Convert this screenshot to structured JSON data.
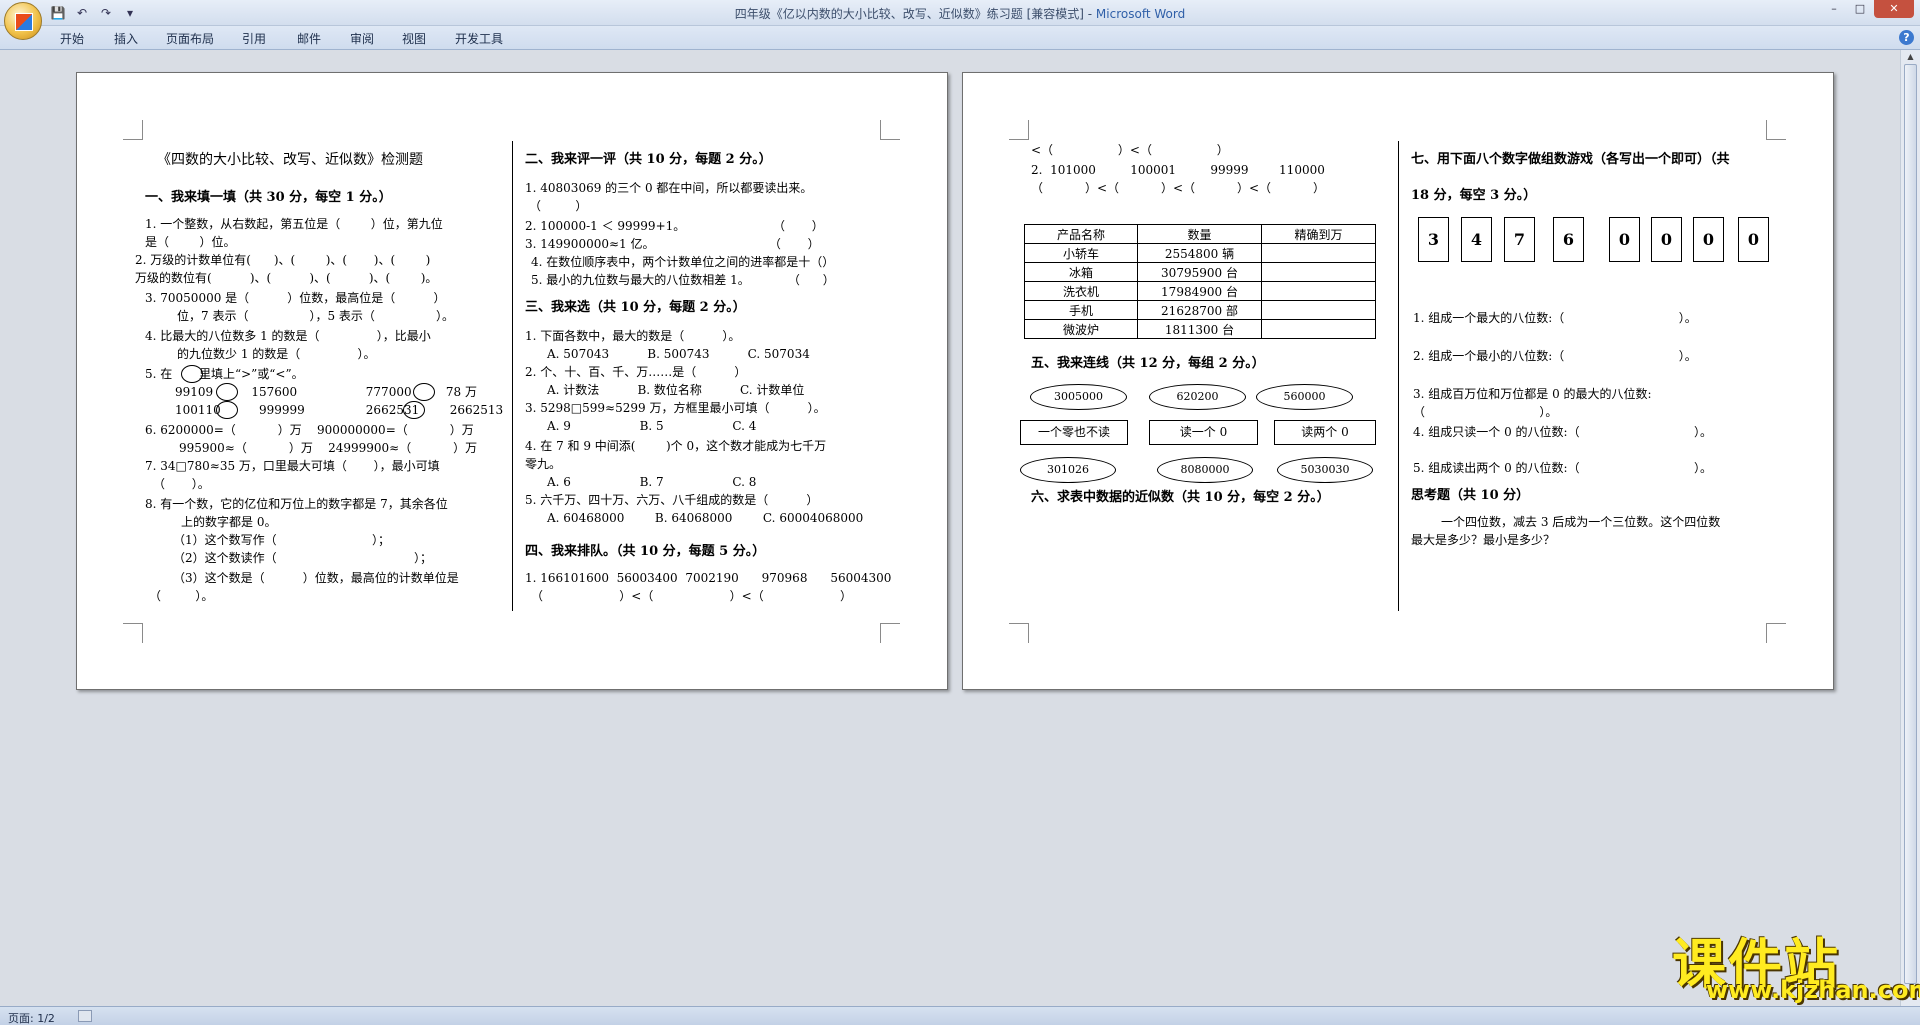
{
  "window": {
    "title": "四年级《亿以内数的大小比较、改写、近似数》练习题 [兼容模式] - ",
    "app_name": "Microsoft Word"
  },
  "ribbon": {
    "tabs": [
      "开始",
      "插入",
      "页面布局",
      "引用",
      "邮件",
      "审阅",
      "视图",
      "开发工具"
    ]
  },
  "status": {
    "page": "页面: 1/2"
  },
  "page1": {
    "title": "《四数的大小比较、改写、近似数》检测题",
    "left": [
      "一、我来填一填（共 30 分，每空 1 分。）",
      "1. 一个整数，从右数起，第五位是（        ）位，第九位",
      "是（        ）位。",
      "2. 万级的计数单位有(      )、(        )、(       )、(        )",
      "万级的数位有(          )、(          )、(          )、(        )。",
      "3. 70050000 是（          ）位数，最高位是（          ）",
      "位，7 表示（                ），5 表示（                ）。",
      "4. 比最大的八位数多 1 的数是（               ），比最小",
      "的九位数少 1 的数是（               ）。",
      "5. 在       里填上“>”或“<”。",
      "99109          157600                  777000         78 万",
      "100110          999999                2662531        2662513",
      "6. 6200000=（           ）万    900000000=（           ）万",
      "995900≈（           ）万    24999900≈（           ）万",
      "7. 34□780≈35 万，口里最大可填（       ），最小可填",
      "（       ）。",
      "8. 有一个数，它的亿位和万位上的数字都是 7，其余各位",
      "上的数字都是 0。",
      "（1）这个数写作（                         ）；",
      "（2）这个数读作（                                    ）；",
      "（3）这个数是（          ）位数，最高位的计数单位是",
      "（         ）。"
    ],
    "right": [
      "二、我来评一评（共 10 分，每题 2 分。）",
      "1. 40803069 的三个 0 都在中间，所以都要读出来。",
      "（         ）",
      "2. 100000-1 ＜ 99999+1。                       （       ）",
      "3. 149900000≈1 亿。                              （       ）",
      "4. 在数位顺序表中，两个计数单位之间的进率都是十（）",
      "5. 最小的九位数与最大的八位数相差 1。          （      ）",
      "三、我来选（共 10 分，每题 2 分。）",
      "1. 下面各数中，最大的数是（          ）。",
      "A. 507043          B. 500743          C. 507034",
      "2. 个、十、百、千、万……是（          ）",
      "A. 计数法          B. 数位名称          C. 计数单位",
      "3. 5298□599≈5299 万，方框里最小可填（          ）。",
      "A. 9                  B. 5                  C. 4",
      "4. 在 7 和 9 中间添(        )个 0，这个数才能成为七千万",
      "零九。",
      "A. 6                  B. 7                  C. 8",
      "5. 六千万、四十万、六万、八千组成的数是（          ）",
      "A. 60468000        B. 64068000        C. 60004068000",
      "四、我来排队。（共 10 分，每题 5 分。）",
      "1. 166101600  56003400  7002190      970968      56004300",
      "（                    ）<（                    ）<（                    ）"
    ]
  },
  "page2": {
    "top_lines": [
      "<（                 ）<（                 ）",
      "2.  101000         100001         99999        110000",
      "（           ）<（           ）<（           ）<（           ）"
    ],
    "table": {
      "headers": [
        "产品名称",
        "数量",
        "精确到万"
      ],
      "rows": [
        [
          "小轿车",
          "2554800 辆",
          ""
        ],
        [
          "冰箱",
          "30795900 台",
          ""
        ],
        [
          "洗衣机",
          "17984900 台",
          ""
        ],
        [
          "手机",
          "21628700 部",
          ""
        ],
        [
          "微波炉",
          "1811300 台",
          ""
        ]
      ]
    },
    "section5": "五、我来连线（共 12 分，每组 2 分。）",
    "ovals_top": [
      "3005000",
      "620200",
      "560000"
    ],
    "boxes": [
      "一个零也不读",
      "读一个 0",
      "读两个 0"
    ],
    "ovals_bottom": [
      "301026",
      "8080000",
      "5030030"
    ],
    "section6": "六、求表中数据的近似数（共 10 分，每空 2 分。）",
    "section7_title": "七、用下面八个数字做组数游戏（各写出一个即可）（共",
    "section7_sub": "18 分，每空 3 分。）",
    "digits": [
      "3",
      "4",
      "7",
      "6",
      "0",
      "0",
      "0",
      "0"
    ],
    "questions": [
      "1. 组成一个最大的八位数:（                              ）。",
      "2. 组成一个最小的八位数:（                              ）。",
      "3. 组成百万位和万位都是 0 的最大的八位数:",
      "（                              ）。",
      "4. 组成只读一个 0 的八位数:（                              ）。",
      "5. 组成读出两个 0 的八位数:（                              ）。"
    ],
    "think_title": "思考题（共 10 分）",
    "think_body": [
      "一个四位数，减去 3 后成为一个三位数。这个四位数",
      "最大是多少？最小是多少？"
    ]
  },
  "watermark": {
    "cn": "课件站",
    "url": "www.kjzhan.com"
  }
}
